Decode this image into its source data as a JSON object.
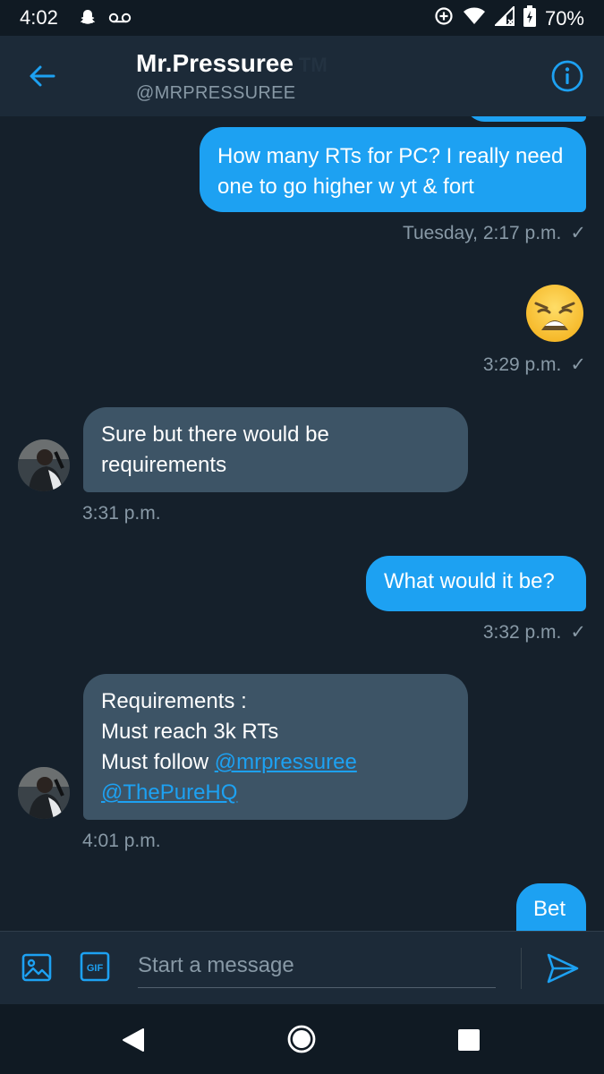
{
  "status_bar": {
    "time": "4:02",
    "battery": "70%",
    "icons": [
      "snapchat-icon",
      "voicemail-icon",
      "data-saver-icon",
      "wifi-icon",
      "signal-icon",
      "battery-icon"
    ]
  },
  "header": {
    "name": "Mr.Pressuree",
    "name_suffix": "TM",
    "handle": "@MRPRESSUREE",
    "back_icon": "arrow-left-icon",
    "info_icon": "info-icon"
  },
  "messages": [
    {
      "direction": "out",
      "text": "How many RTs for PC? I really need one to go higher w yt & fort",
      "time": "Tuesday, 2:17 p.m.",
      "check": "✓"
    },
    {
      "direction": "out",
      "emoji": "weary-face",
      "time": "3:29 p.m.",
      "check": "✓"
    },
    {
      "direction": "in",
      "text": "Sure but there would be requirements",
      "time": "3:31 p.m."
    },
    {
      "direction": "out",
      "text": "What would it be?",
      "time": "3:32 p.m.",
      "check": "✓"
    },
    {
      "direction": "in",
      "lines": [
        "Requirements :",
        "Must reach 3k RTs",
        "Must follow"
      ],
      "links": [
        "@mrpressuree",
        "@ThePureHQ"
      ],
      "time": "4:01 p.m."
    },
    {
      "direction": "out",
      "text": "Bet"
    }
  ],
  "composer": {
    "placeholder": "Start a message",
    "gif_label": "GIF",
    "icons": [
      "image-icon",
      "gif-icon",
      "send-icon"
    ]
  },
  "colors": {
    "background": "#15202b",
    "header": "#1c2a38",
    "accent": "#1da1f2",
    "incoming_bubble": "#3d5466",
    "muted_text": "#8899a6"
  }
}
